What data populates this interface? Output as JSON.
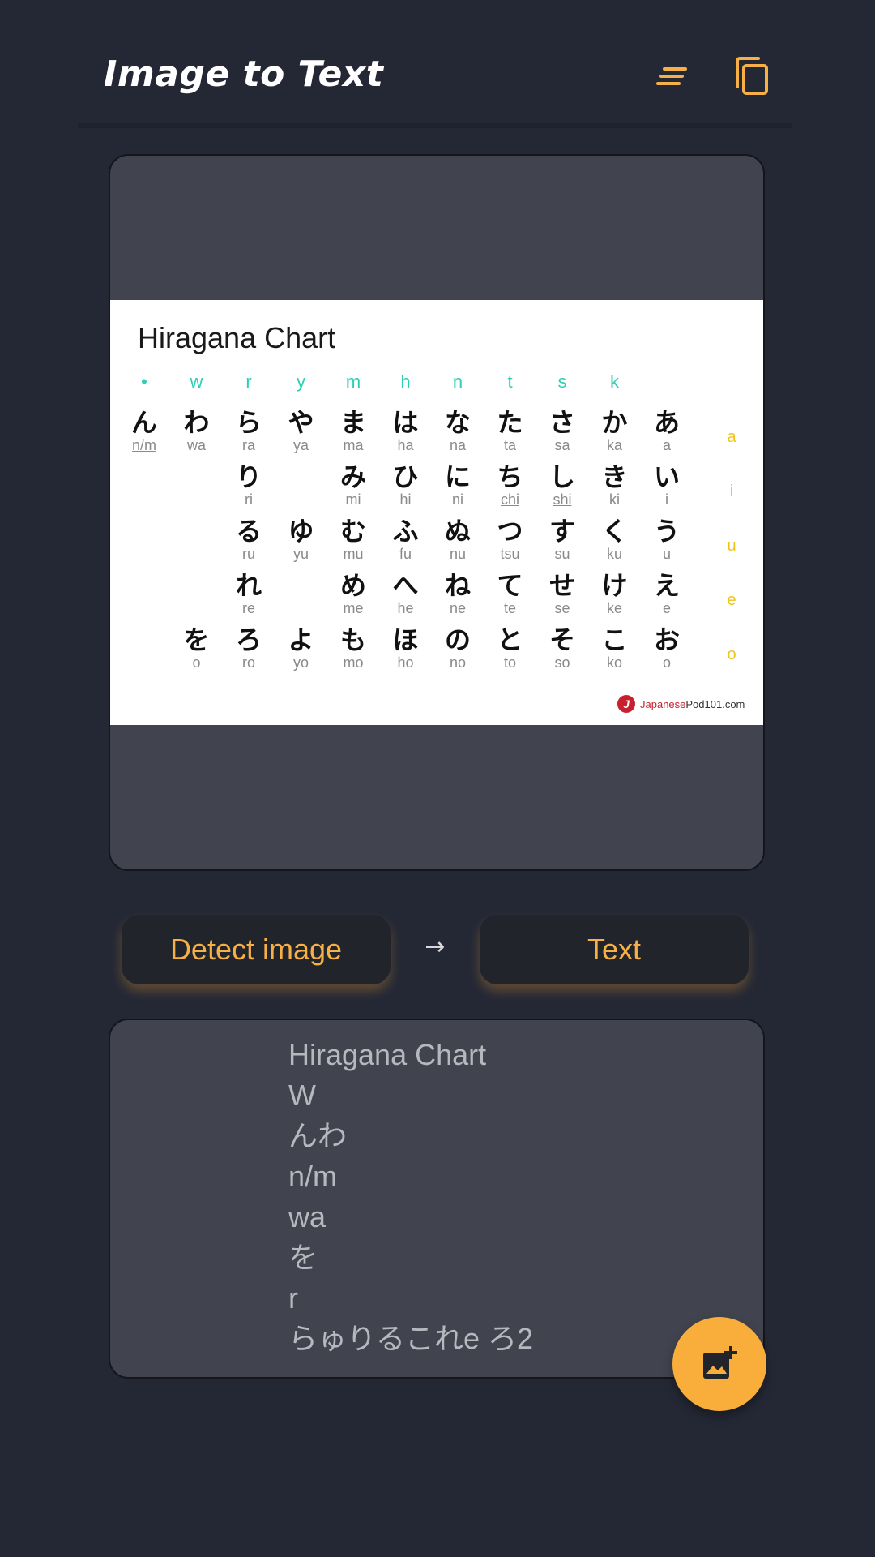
{
  "app": {
    "title": "Image to Text"
  },
  "toolbar": {
    "menu_icon": "sort-lines-icon",
    "copy_icon": "copy-icon"
  },
  "chart": {
    "title": "Hiragana Chart",
    "consonants": [
      "•",
      "w",
      "r",
      "y",
      "m",
      "h",
      "n",
      "t",
      "s",
      "k",
      ""
    ],
    "vowels": [
      "a",
      "i",
      "u",
      "e",
      "o"
    ],
    "rows": [
      [
        [
          "ん",
          "n/m"
        ],
        [
          "わ",
          "wa"
        ],
        [
          "ら",
          "ra"
        ],
        [
          "や",
          "ya"
        ],
        [
          "ま",
          "ma"
        ],
        [
          "は",
          "ha"
        ],
        [
          "な",
          "na"
        ],
        [
          "た",
          "ta"
        ],
        [
          "さ",
          "sa"
        ],
        [
          "か",
          "ka"
        ],
        [
          "あ",
          "a"
        ]
      ],
      [
        null,
        null,
        [
          "り",
          "ri"
        ],
        null,
        [
          "み",
          "mi"
        ],
        [
          "ひ",
          "hi"
        ],
        [
          "に",
          "ni"
        ],
        [
          "ち",
          "chi"
        ],
        [
          "し",
          "shi"
        ],
        [
          "き",
          "ki"
        ],
        [
          "い",
          "i"
        ]
      ],
      [
        null,
        null,
        [
          "る",
          "ru"
        ],
        [
          "ゆ",
          "yu"
        ],
        [
          "む",
          "mu"
        ],
        [
          "ふ",
          "fu"
        ],
        [
          "ぬ",
          "nu"
        ],
        [
          "つ",
          "tsu"
        ],
        [
          "す",
          "su"
        ],
        [
          "く",
          "ku"
        ],
        [
          "う",
          "u"
        ]
      ],
      [
        null,
        null,
        [
          "れ",
          "re"
        ],
        null,
        [
          "め",
          "me"
        ],
        [
          "へ",
          "he"
        ],
        [
          "ね",
          "ne"
        ],
        [
          "て",
          "te"
        ],
        [
          "せ",
          "se"
        ],
        [
          "け",
          "ke"
        ],
        [
          "え",
          "e"
        ]
      ],
      [
        null,
        [
          "を",
          "o"
        ],
        [
          "ろ",
          "ro"
        ],
        [
          "よ",
          "yo"
        ],
        [
          "も",
          "mo"
        ],
        [
          "ほ",
          "ho"
        ],
        [
          "の",
          "no"
        ],
        [
          "と",
          "to"
        ],
        [
          "そ",
          "so"
        ],
        [
          "こ",
          "ko"
        ],
        [
          "お",
          "o"
        ]
      ]
    ],
    "underlined": [
      "n/m",
      "chi",
      "shi",
      "tsu"
    ],
    "brand_mark": "J",
    "brand_red": "Japanese",
    "brand_rest": "Pod101.com"
  },
  "actions": {
    "detect_label": "Detect image",
    "arrow": "→",
    "text_label": "Text"
  },
  "result": {
    "lines": [
      "Hiragana Chart",
      "W",
      "んわ",
      "n/m",
      "wa",
      "を",
      "r",
      "らゅりるこれe ろ2"
    ]
  },
  "fab": {
    "icon": "add-image-icon"
  },
  "colors": {
    "background": "#242835",
    "card": "#41444f",
    "accent": "#f6b046",
    "consonant": "#2ccfb4",
    "vowel": "#f0c419"
  }
}
